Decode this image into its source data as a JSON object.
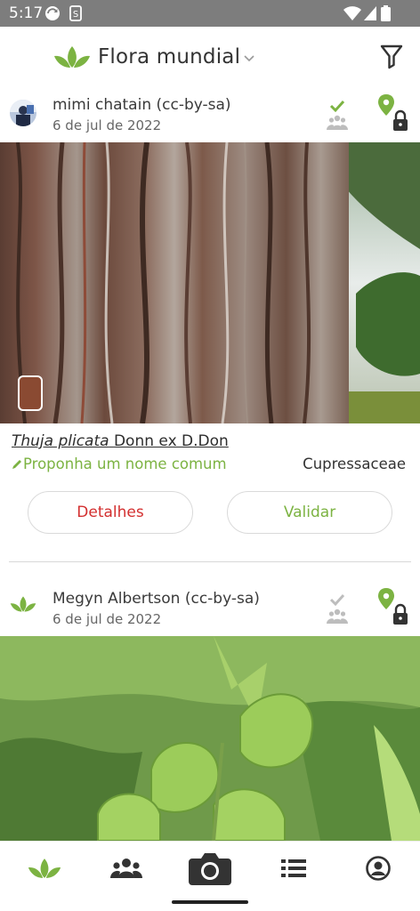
{
  "status_bar": {
    "time": "5:17",
    "left_icons": [
      "sync-icon",
      "sim-icon"
    ],
    "right_icons": [
      "wifi-icon",
      "signal-icon",
      "battery-icon"
    ]
  },
  "header": {
    "app_title": "Flora mundial",
    "logo_icon": "leaf-logo-icon",
    "dropdown_icon": "chevron-down-icon",
    "filter_icon": "filter-icon"
  },
  "observations": [
    {
      "author": "mimi chatain (cc-by-sa)",
      "date": "6 de jul de 2022",
      "avatar_icon": "user-avatar",
      "validation_status": "validated",
      "location_status": "private",
      "scientific_name": "Thuja plicata",
      "scientific_authority": "Donn ex D.Don",
      "propose_common_name": "Proponha um nome comum",
      "family": "Cupressaceae",
      "organ": "bark",
      "actions": {
        "details": "Detalhes",
        "validate": "Validar"
      }
    },
    {
      "author": "Megyn Albertson (cc-by-sa)",
      "date": "6 de jul de 2022",
      "avatar_icon": "leaf-avatar-icon",
      "validation_status": "pending",
      "location_status": "private"
    }
  ],
  "bottom_nav": {
    "items": [
      "home-leaf-icon",
      "community-icon",
      "camera-icon",
      "list-icon",
      "profile-icon"
    ]
  },
  "colors": {
    "brand_green": "#7cb342",
    "details_red": "#d32f2f",
    "status_bar": "#7d7d7d"
  }
}
